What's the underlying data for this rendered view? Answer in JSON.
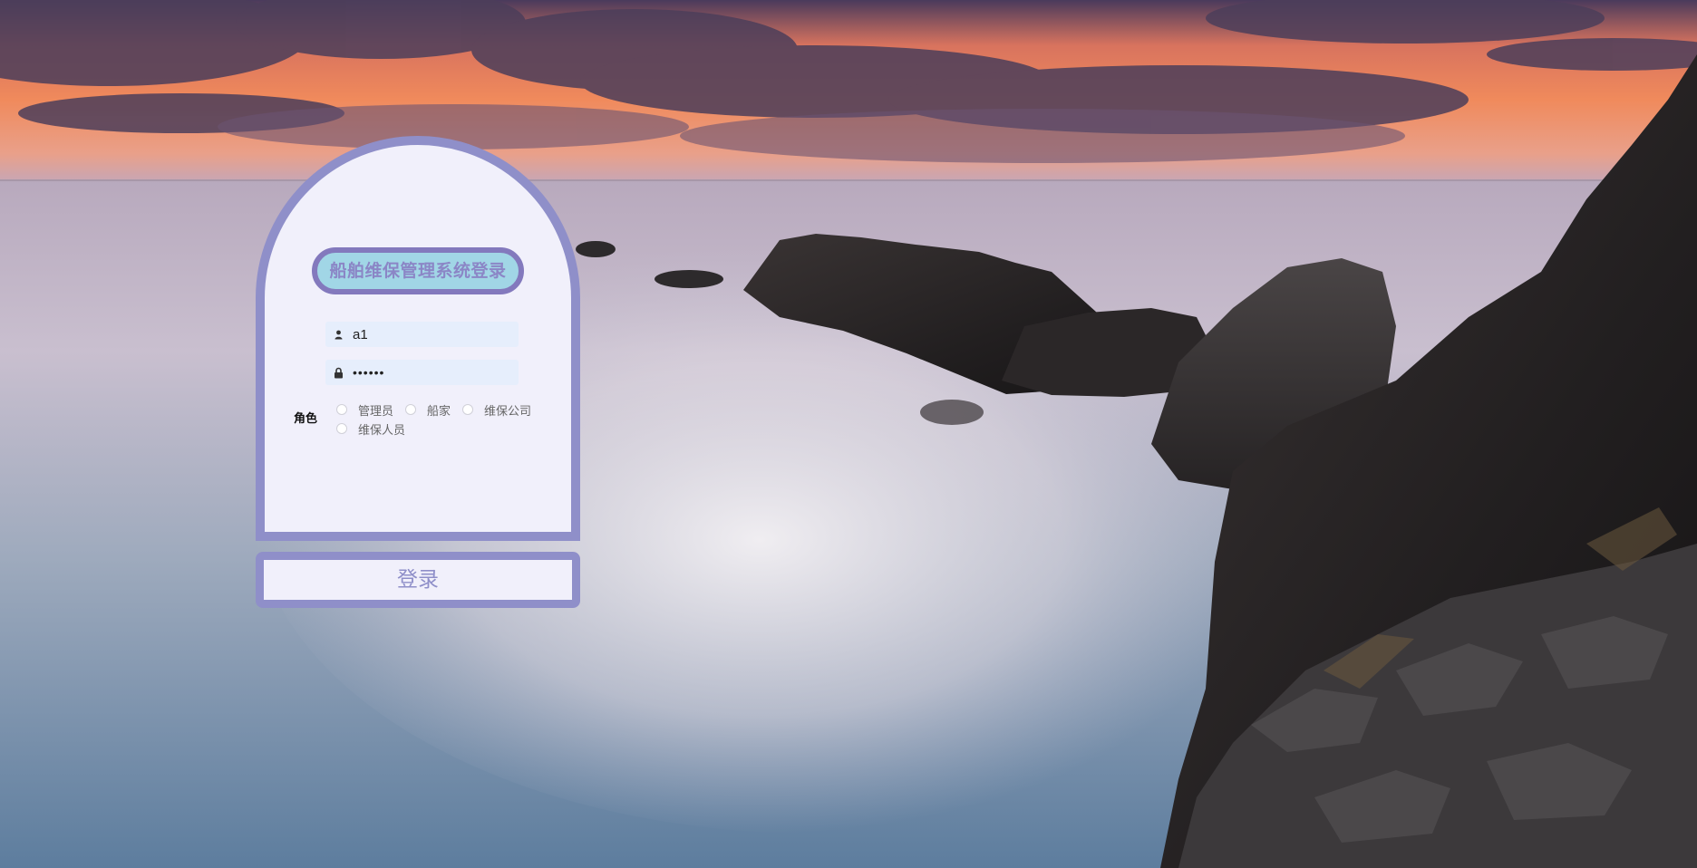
{
  "login": {
    "title": "船舶维保管理系统登录",
    "username": {
      "value": "a1",
      "icon": "user-icon"
    },
    "password": {
      "value": "••••••",
      "icon": "lock-icon"
    },
    "role_label": "角色",
    "roles": [
      "管理员",
      "船家",
      "维保公司",
      "维保人员"
    ],
    "submit_label": "登录"
  },
  "colors": {
    "card_border": "#8f8fc9",
    "card_bg": "#f1f0fb",
    "title_pill_bg": "#a1d6e6",
    "title_pill_border": "#8379bd",
    "input_bg": "#e6eefc"
  },
  "background": {
    "scene": "sunset-seascape-with-rocky-coast"
  }
}
